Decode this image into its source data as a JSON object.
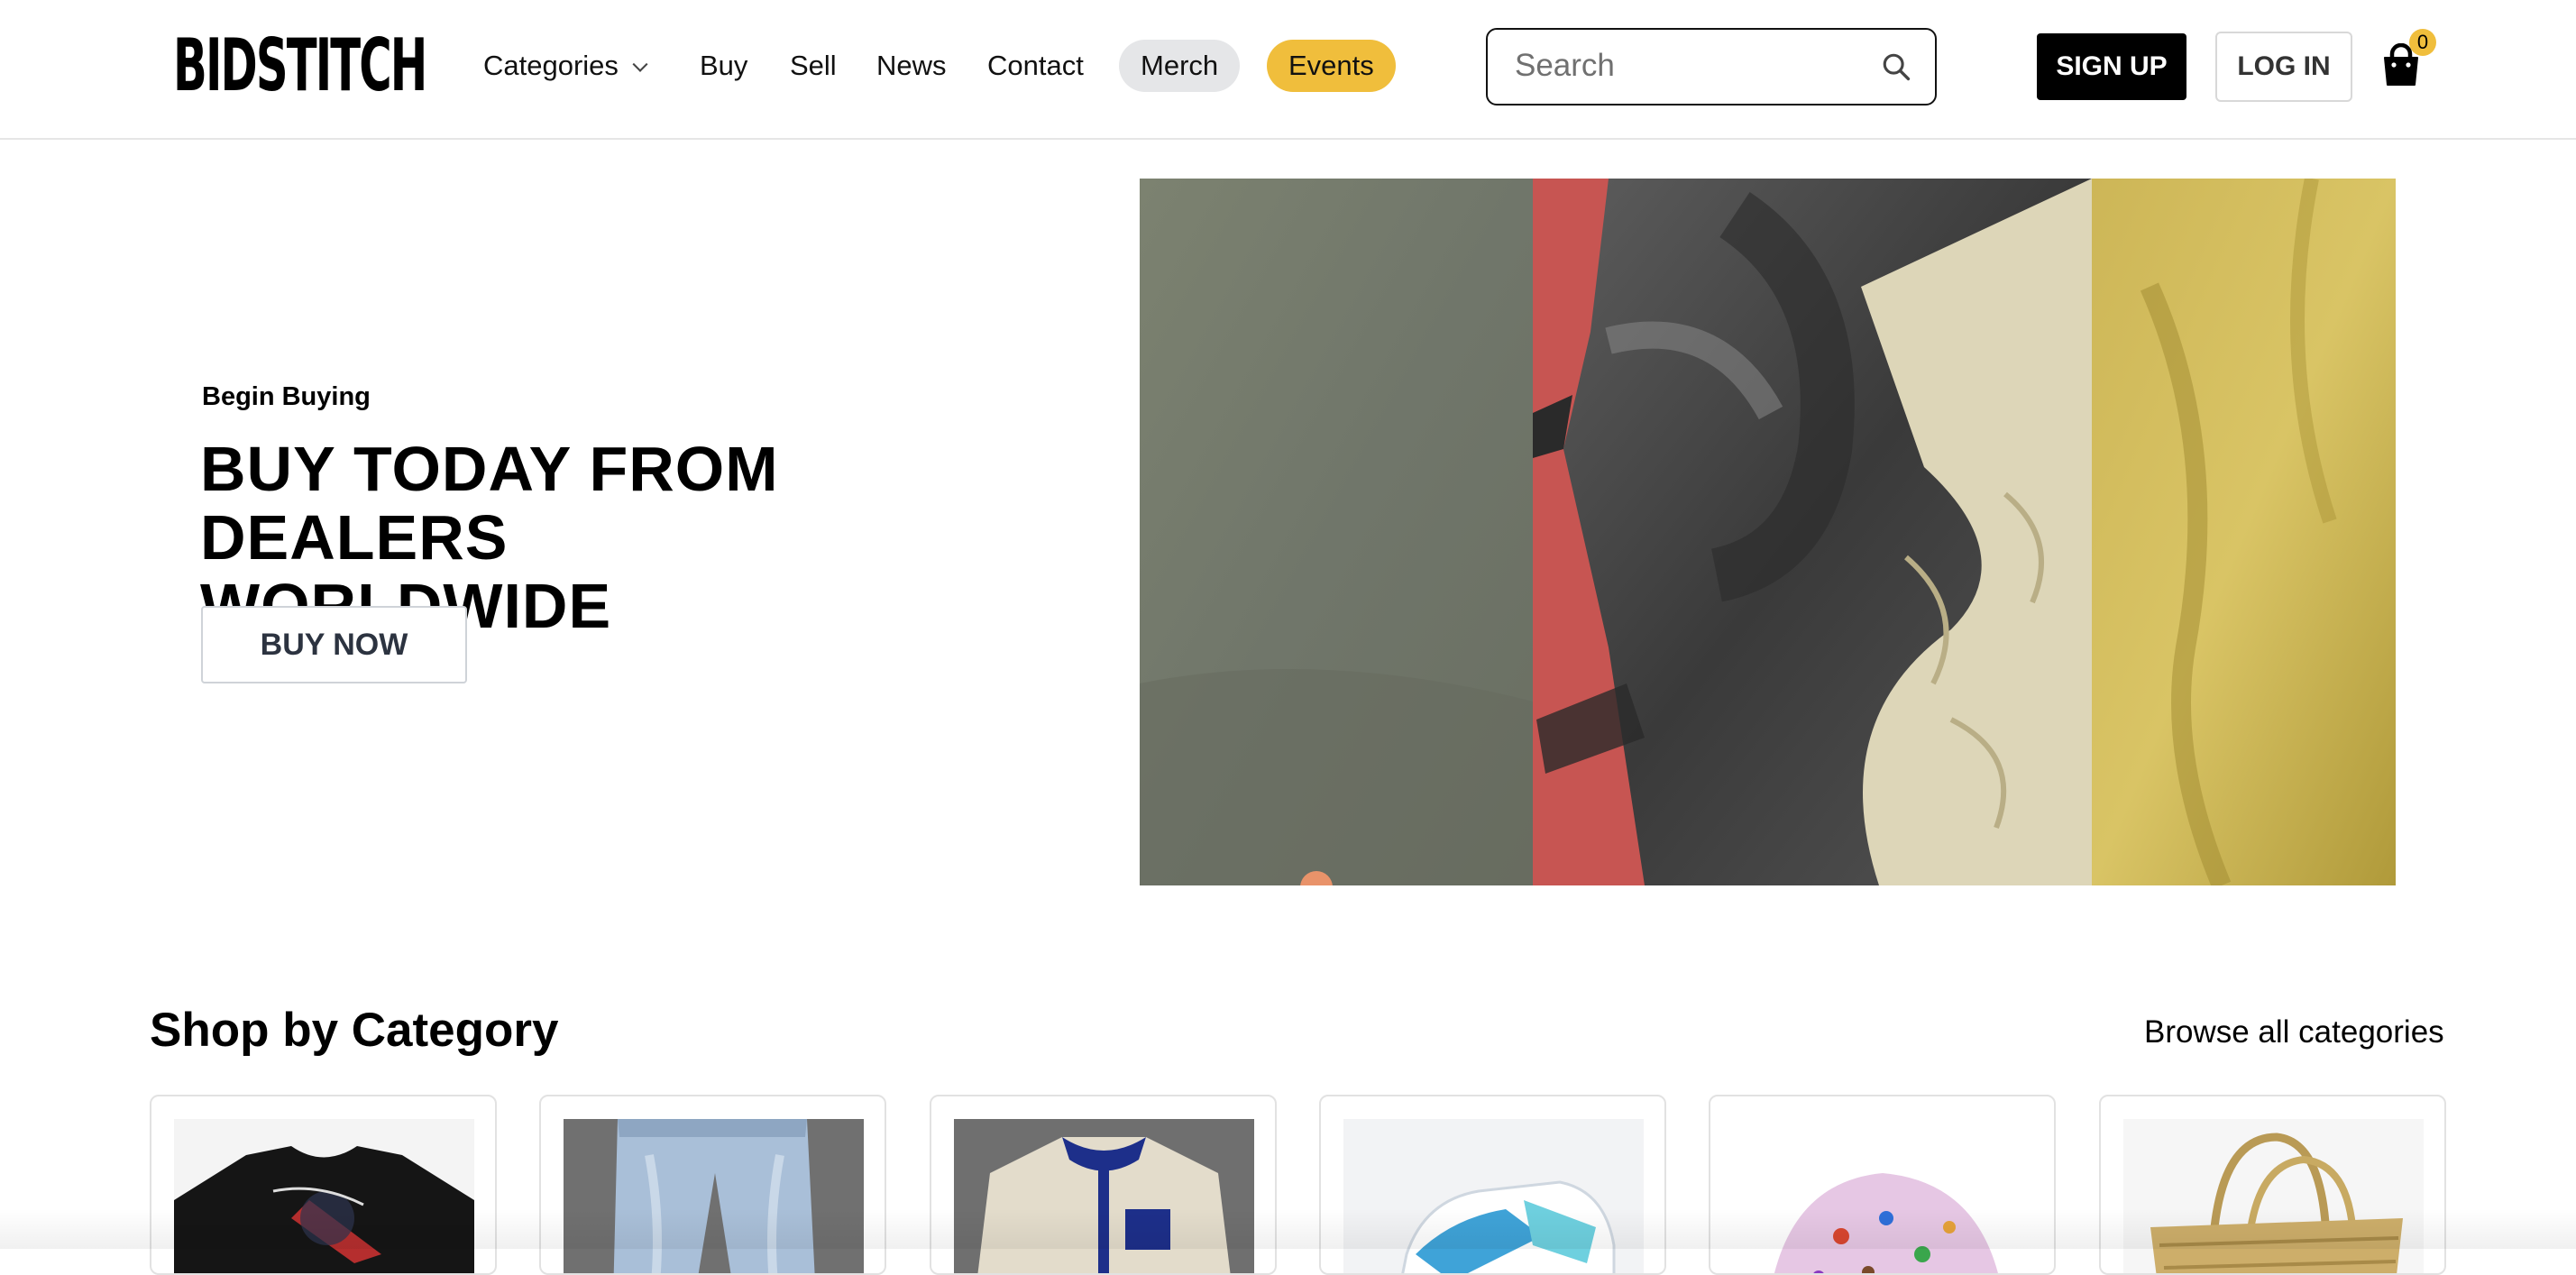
{
  "brand": {
    "logo_text": "BIDSTITCH"
  },
  "nav": {
    "categories": "Categories",
    "buy": "Buy",
    "sell": "Sell",
    "news": "News",
    "contact": "Contact",
    "merch": "Merch",
    "events": "Events"
  },
  "search": {
    "placeholder": "Search",
    "value": ""
  },
  "auth": {
    "signup_label": "SIGN UP",
    "login_label": "LOG IN"
  },
  "cart": {
    "count": "0"
  },
  "hero": {
    "kicker": "Begin Buying",
    "title_line1": "BUY TODAY FROM DEALERS",
    "title_line2": "WORLDWIDE",
    "cta_label": "BUY NOW"
  },
  "categories_section": {
    "title": "Shop by Category",
    "browse_all_label": "Browse all categories",
    "cards": [
      {
        "image": "graphic-tshirt-black"
      },
      {
        "image": "light-wash-jeans"
      },
      {
        "image": "fleece-jacket-cream-navy"
      },
      {
        "image": "sneakers-blue-white"
      },
      {
        "image": "monogram-cap-pink"
      },
      {
        "image": "woven-straw-bag"
      }
    ]
  },
  "colors": {
    "accent_yellow": "#f0be3c",
    "merch_pill": "#e5e6e8",
    "signup_bg": "#000000",
    "text": "#000000"
  },
  "icons": {
    "search": "search-icon",
    "cart": "shopping-bag-icon",
    "dropdown": "chevron-down-icon"
  }
}
